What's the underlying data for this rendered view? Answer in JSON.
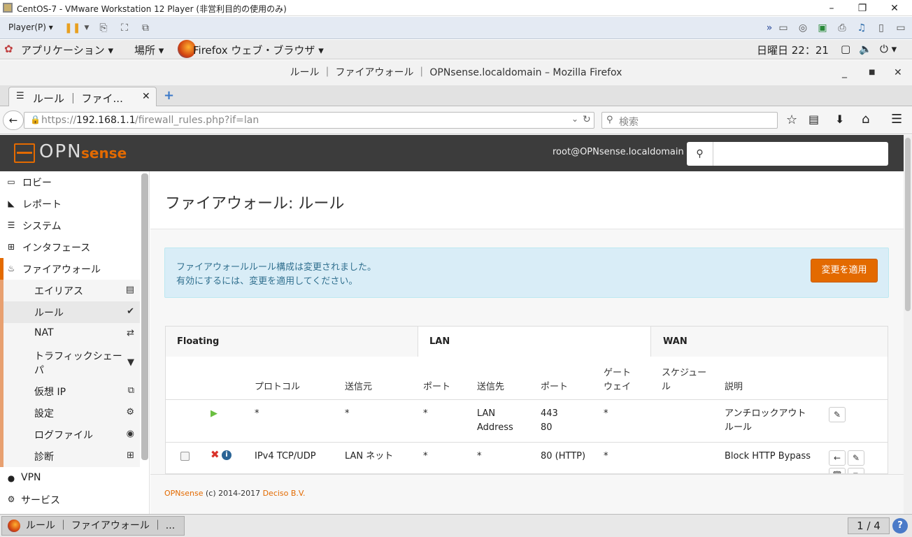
{
  "vm": {
    "title": "CentOS-7 - VMware Workstation 12 Player (非営利目的の使用のみ)",
    "player_menu": "Player(P)"
  },
  "gnome": {
    "apps": "アプリケーション",
    "places": "場所",
    "firefox": "Firefox ウェブ・ブラウザ",
    "clock": "日曜日 22：21"
  },
  "firefox": {
    "window_title": "ルール ｜ ファイアウォール ｜ OPNsense.localdomain – Mozilla Firefox",
    "tab_label": "ルール ｜ ファイ...",
    "url_prefix": "https://",
    "url_host": "192.168.1.1",
    "url_path": "/firewall_rules.php?if=lan",
    "search_placeholder": "検索"
  },
  "opn": {
    "user": "root@OPNsense.localdomain",
    "logo_left": "OPN",
    "logo_right": "sense",
    "page_title": "ファイアウォール: ルール",
    "alert_line1": "ファイアウォールルール構成は変更されました。",
    "alert_line2": "有効にするには、変更を適用してください。",
    "apply_button": "変更を適用",
    "footer_brand": "OPNsense",
    "footer_text": " (c) 2014-2017 ",
    "footer_company": "Deciso B.V."
  },
  "sidebar": {
    "items": [
      {
        "label": "ロビー",
        "icon": "laptop-icon"
      },
      {
        "label": "レポート",
        "icon": "area-chart-icon"
      },
      {
        "label": "システム",
        "icon": "server-icon"
      },
      {
        "label": "インタフェース",
        "icon": "sitemap-icon"
      },
      {
        "label": "ファイアウォール",
        "icon": "fire-icon"
      }
    ],
    "sub": [
      {
        "label": "エイリアス",
        "icon": "list-icon"
      },
      {
        "label": "ルール",
        "icon": "check-icon"
      },
      {
        "label": "NAT",
        "icon": "exchange-icon"
      },
      {
        "label": "トラフィックシェー",
        "label2": "パ",
        "icon": "filter-icon"
      },
      {
        "label": "仮想 IP",
        "icon": "clone-icon"
      },
      {
        "label": "設定",
        "icon": "cogs-icon"
      },
      {
        "label": "ログファイル",
        "icon": "eye-icon"
      },
      {
        "label": "診断",
        "icon": "medkit-icon"
      }
    ],
    "bottom": [
      {
        "label": "VPN",
        "icon": "globe-icon"
      },
      {
        "label": "サービス",
        "icon": "gear-icon"
      }
    ]
  },
  "rule_tabs": [
    "Floating",
    "LAN",
    "WAN"
  ],
  "table": {
    "headers": [
      "プロトコル",
      "送信元",
      "ポート",
      "送信先",
      "ポート",
      "ゲート",
      "ウェイ",
      "スケジュー",
      "ル",
      "説明"
    ],
    "rows": [
      {
        "protocol": "*",
        "source": "*",
        "sport": "*",
        "dest1": "LAN",
        "dest2": "Address",
        "dport1": "443",
        "dport2": "80",
        "gateway": "*",
        "desc1": "アンチロックアウト",
        "desc2": "ルール"
      },
      {
        "protocol": "IPv4 TCP/UDP",
        "source": "LAN ネット",
        "sport": "*",
        "dest1": "*",
        "dest2": "",
        "dport1": "80 (HTTP)",
        "dport2": "",
        "gateway": "*",
        "desc1": "Block HTTP Bypass",
        "desc2": ""
      }
    ]
  },
  "taskbar": {
    "task": "ルール ｜ ファイアウォール ｜ ...",
    "workspace": "1 / 4"
  },
  "colors": {
    "accent": "#e36a00",
    "header": "#3c3c3c",
    "alert_bg": "#d9edf7"
  }
}
